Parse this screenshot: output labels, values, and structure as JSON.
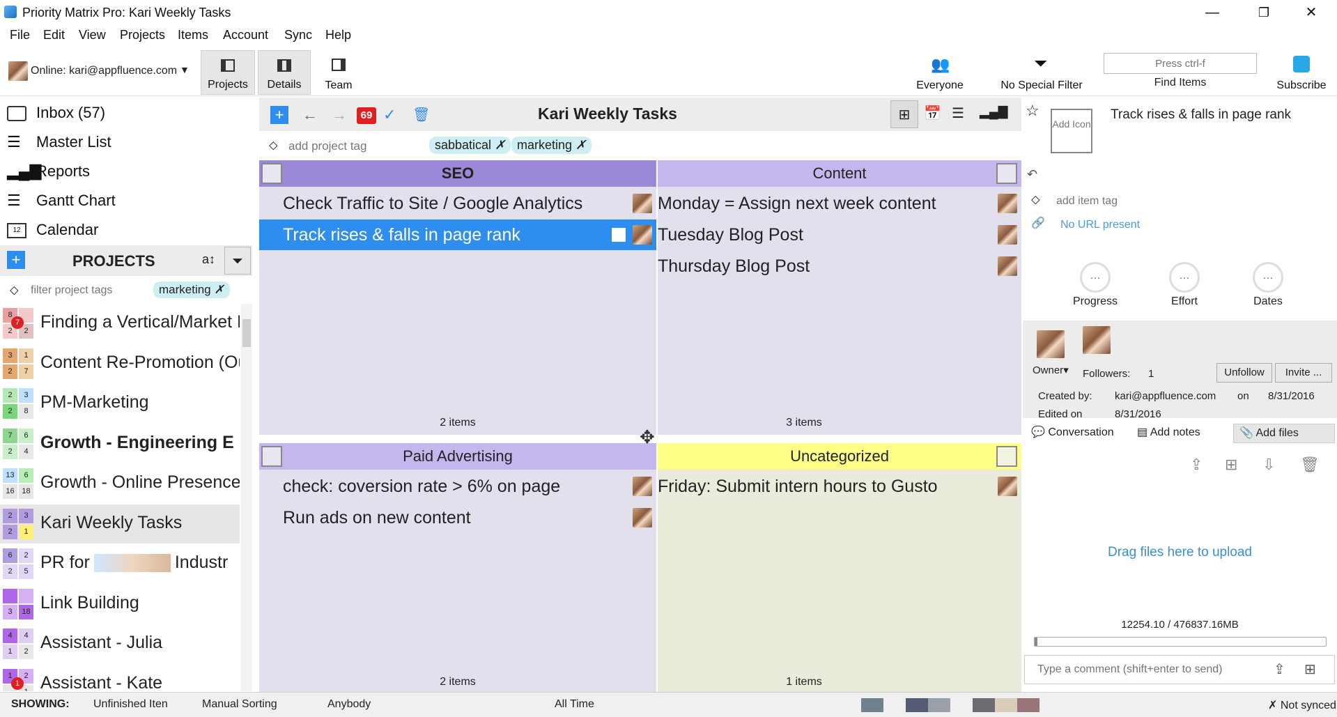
{
  "window": {
    "title": "Priority Matrix Pro: Kari Weekly Tasks",
    "minimize": "—",
    "restore": "❐",
    "close": "✕"
  },
  "menu": [
    "File",
    "Edit",
    "View",
    "Projects",
    "Items",
    "Account",
    "Sync",
    "Help"
  ],
  "toolbar": {
    "account": "Online: kari@appfluence.com",
    "projects_label": "Projects",
    "details_label": "Details",
    "team_label": "Team",
    "everyone_label": "Everyone",
    "filter_label": "No Special Filter",
    "find_placeholder": "Press ctrl-f",
    "find_label": "Find Items",
    "subscribe_label": "Subscribe"
  },
  "sidebar": {
    "nav": [
      {
        "label": "Inbox (57)"
      },
      {
        "label": "Master List"
      },
      {
        "label": "Reports"
      },
      {
        "label": "Gantt Chart"
      },
      {
        "label": "Calendar"
      }
    ],
    "projects_title": "PROJECTS",
    "filter_placeholder": "filter project tags",
    "filter_tag": "marketing",
    "projects": [
      {
        "name": "Finding a Vertical/Market R",
        "counts": [
          "8",
          "",
          "2",
          "2"
        ],
        "colors": [
          "#e8a0a0",
          "#f3c9c9",
          "#f3c9c9",
          "#e0c0c0"
        ],
        "badge": "7"
      },
      {
        "name": "Content Re-Promotion (Ou",
        "counts": [
          "3",
          "1",
          "2",
          "7"
        ],
        "colors": [
          "#e3a86f",
          "#f0d0a8",
          "#e3a86f",
          "#f0d0a8"
        ],
        "badge": ""
      },
      {
        "name": "PM-Marketing",
        "counts": [
          "2",
          "3",
          "2",
          "8"
        ],
        "colors": [
          "#b5e8b5",
          "#bfe0ff",
          "#7bd67b",
          "#e8e8e8"
        ],
        "badge": ""
      },
      {
        "name": "Growth - Engineering E",
        "counts": [
          "7",
          "6",
          "2",
          "4"
        ],
        "colors": [
          "#8fd68f",
          "#c9efc9",
          "#c9efc9",
          "#e8e8e8"
        ],
        "badge": ""
      },
      {
        "name": "Growth - Online Presence",
        "counts": [
          "13",
          "6",
          "16",
          "18"
        ],
        "colors": [
          "#bfe0ff",
          "#b7f0b7",
          "#e6e6e6",
          "#e6e6e6"
        ],
        "badge": ""
      },
      {
        "name": "Kari Weekly Tasks",
        "counts": [
          "2",
          "3",
          "2",
          "1"
        ],
        "colors": [
          "#b19ce0",
          "#b19ce0",
          "#b19ce0",
          "#ffef7a"
        ],
        "badge": ""
      },
      {
        "name": "PR for",
        "counts": [
          "6",
          "2",
          "2",
          "5"
        ],
        "colors": [
          "#b19ce0",
          "#e0d6f5",
          "#e0d6f5",
          "#e0d6f5"
        ],
        "badge": ""
      },
      {
        "name": "Link Building",
        "counts": [
          "",
          "",
          "3",
          "18"
        ],
        "colors": [
          "#b066e8",
          "#d6b0f5",
          "#d6b0f5",
          "#b066e8"
        ],
        "badge": ""
      },
      {
        "name": "Assistant - Julia",
        "counts": [
          "4",
          "4",
          "1",
          "2"
        ],
        "colors": [
          "#b066e8",
          "#e0cdf5",
          "#e0cdf5",
          "#e8e8e8"
        ],
        "badge": ""
      },
      {
        "name": "Assistant - Kate",
        "counts": [
          "1",
          "2",
          "",
          "1"
        ],
        "colors": [
          "#b066e8",
          "#d6b0f5",
          "#e8e8e8",
          "#e8e8e8"
        ],
        "badge": "1"
      }
    ],
    "pr_suffix": "Industr"
  },
  "center": {
    "title": "Kari Weekly Tasks",
    "badge": "69",
    "add_tag_placeholder": "add project tag",
    "tags": [
      "sabbatical",
      "marketing"
    ],
    "quadrants": [
      {
        "name": "SEO",
        "tasks": [
          "Check Traffic to Site / Google Analytics",
          "Track rises & falls in page rank"
        ],
        "count": "2 items"
      },
      {
        "name": "Content",
        "tasks": [
          "Monday = Assign next week content",
          "Tuesday Blog Post",
          "Thursday Blog Post"
        ],
        "count": "3 items"
      },
      {
        "name": "Paid Advertising",
        "tasks": [
          "check: coversion rate > 6% on page",
          "Run ads on new content"
        ],
        "count": "2 items"
      },
      {
        "name": "Uncategorized",
        "tasks": [
          "Friday: Submit intern hours to Gusto"
        ],
        "count": "1 items"
      }
    ]
  },
  "details": {
    "title": "Track rises & falls in page rank",
    "add_icon": "Add Icon",
    "add_tag_placeholder": "add item tag",
    "url": "No URL present",
    "metrics": [
      "Progress",
      "Effort",
      "Dates"
    ],
    "owner_label": "Owner",
    "followers_label": "Followers:",
    "followers_count": "1",
    "unfollow": "Unfollow",
    "invite": "Invite ...",
    "created_by_label": "Created by:",
    "created_by": "kari@appfluence.com",
    "on_label": "on",
    "created_date": "8/31/2016",
    "edited_label": "Edited on",
    "edited_date": "8/31/2016",
    "tabs": [
      "Conversation",
      "Add notes",
      "Add files"
    ],
    "drop_text": "Drag files here to upload",
    "storage": "12254.10 / 476837.16MB",
    "comment_placeholder": "Type a comment (shift+enter to send)"
  },
  "status": {
    "showing": "SHOWING:",
    "filter": "Unfinished Iten",
    "sorting": "Manual Sorting",
    "who": "Anybody",
    "when": "All Time",
    "sync": "Not synced"
  },
  "colors": {
    "seo": "#9b88d6",
    "content": "#c5b6ee",
    "paid": "#c5b6ee",
    "uncat": "#ffff88",
    "selected": "#2e8ef0",
    "quad_bg": "#e2e0ec",
    "uncat_bg": "#ebebdc"
  }
}
